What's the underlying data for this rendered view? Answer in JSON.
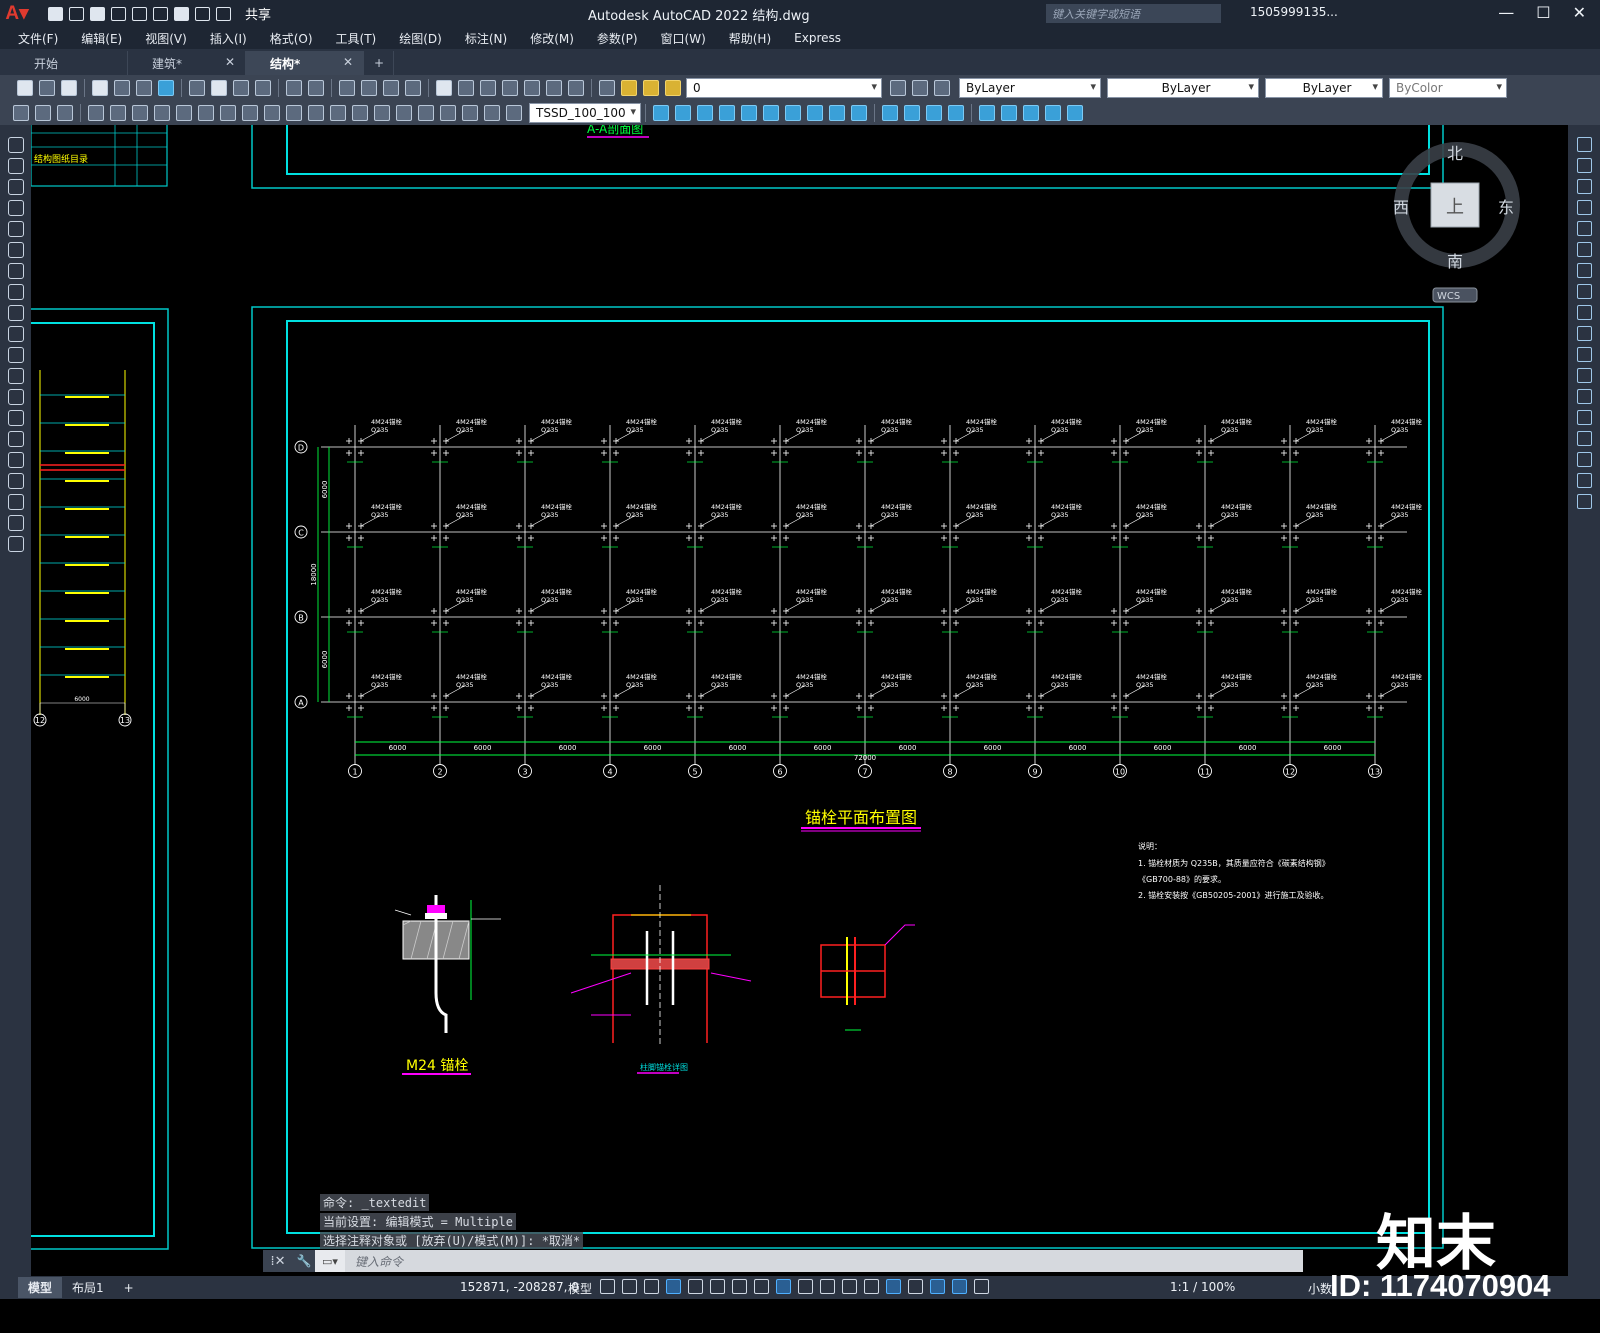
{
  "app": {
    "title": "Autodesk AutoCAD 2022    结构.dwg",
    "search_placeholder": "键入关键字或短语",
    "user": "1505999135...",
    "share": "共享"
  },
  "menu": [
    "文件(F)",
    "编辑(E)",
    "视图(V)",
    "插入(I)",
    "格式(O)",
    "工具(T)",
    "绘图(D)",
    "标注(N)",
    "修改(M)",
    "参数(P)",
    "窗口(W)",
    "帮助(H)",
    "Express"
  ],
  "tabs": [
    {
      "label": "开始",
      "close": ""
    },
    {
      "label": "建筑*",
      "close": "✕"
    },
    {
      "label": "结构*",
      "close": "✕"
    }
  ],
  "toolbar": {
    "layer": "0",
    "color": "ByLayer",
    "linetype": "ByLayer",
    "lineweight": "ByLayer",
    "plotstyle": "ByColor",
    "dimstyle": "TSSD_100_100"
  },
  "viewcube": {
    "north": "北",
    "south": "南",
    "east": "东",
    "west": "西",
    "top": "上",
    "wcs": "WCS"
  },
  "drawing": {
    "top_title": "A-A剖面图",
    "left_index_title": "结构图纸目录",
    "grid_rows": [
      "D",
      "C",
      "B",
      "A"
    ],
    "grid_cols": [
      "1",
      "2",
      "3",
      "4",
      "5",
      "6",
      "7",
      "8",
      "9",
      "10",
      "11",
      "12",
      "13"
    ],
    "bolt_tag": "4M24锚栓",
    "bolt_mat": "Q235",
    "dim_bay": "6000",
    "dim_total": "72000",
    "dim_row": "6000",
    "dim_total_y": "18000",
    "dim_left": "6000",
    "plan_title": "锚栓平面布置图",
    "detail1_title": "M24 锚栓",
    "detail2_title": "柱脚锚栓详图",
    "notes": [
      "说明：",
      "1. 锚栓材质为 Q235B，其质量应符合《碳素结构钢》",
      "   《GB700-88》的要求。",
      "2. 锚栓安装按《GB50205-2001》进行施工及验收。"
    ],
    "left_frame_dim": "6000",
    "left_axis": [
      "12",
      "13"
    ]
  },
  "command": {
    "history": [
      "命令: _textedit",
      "当前设置: 编辑模式 = Multiple",
      "选择注释对象或 [放弃(U)/模式(M)]: *取消*"
    ],
    "placeholder": "键入命令"
  },
  "status": {
    "tabs": [
      "模型",
      "布局1"
    ],
    "coords": "152871, -208287, 0",
    "model": "模型",
    "scale": "1:1 / 100%",
    "decimal": "小数"
  },
  "watermark": {
    "brand": "知末",
    "id": "ID: 1174070904"
  }
}
